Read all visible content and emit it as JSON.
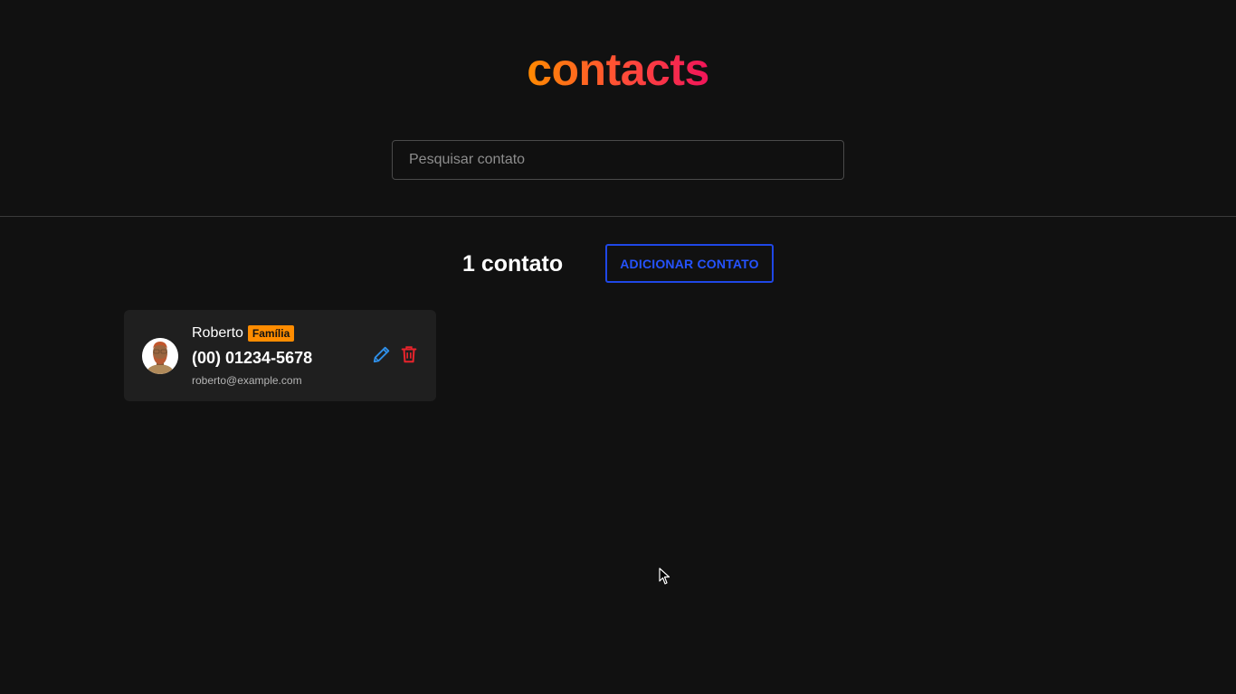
{
  "header": {
    "logo_text": "contacts",
    "search_placeholder": "Pesquisar contato"
  },
  "toolbar": {
    "count_text": "1 contato",
    "add_label": "ADICIONAR CONTATO"
  },
  "contacts": [
    {
      "name": "Roberto",
      "tag": "Família",
      "phone": "(00) 01234-5678",
      "email": "roberto@example.com"
    }
  ],
  "colors": {
    "background": "#111111",
    "card": "#1f1f1f",
    "accent_blue": "#2553ff",
    "tag": "#ff8c00",
    "edit_icon": "#2f8fe8",
    "delete_icon": "#e8242c"
  },
  "icons": {
    "edit": "pencil-icon",
    "delete": "trash-icon",
    "avatar": "person-avatar"
  }
}
